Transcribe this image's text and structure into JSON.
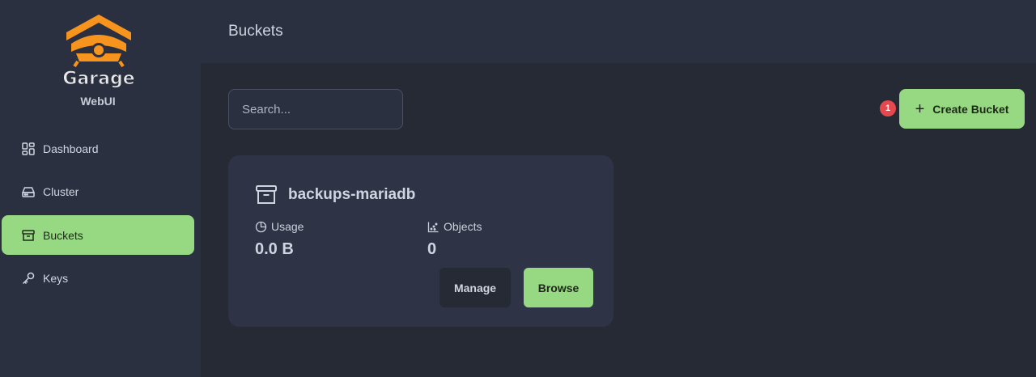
{
  "app": {
    "logo_text": "Garage",
    "subtitle": "WebUI"
  },
  "sidebar": {
    "items": [
      {
        "label": "Dashboard",
        "icon": "dashboard-icon",
        "active": false
      },
      {
        "label": "Cluster",
        "icon": "server-icon",
        "active": false
      },
      {
        "label": "Buckets",
        "icon": "archive-icon",
        "active": true
      },
      {
        "label": "Keys",
        "icon": "key-icon",
        "active": false
      }
    ]
  },
  "header": {
    "title": "Buckets"
  },
  "toolbar": {
    "search_placeholder": "Search...",
    "notification_count": "1",
    "create_label": "Create Bucket",
    "create_icon": "plus-icon"
  },
  "bucket": {
    "name": "backups-mariadb",
    "usage_label": "Usage",
    "usage_value": "0.0 B",
    "objects_label": "Objects",
    "objects_value": "0",
    "manage_label": "Manage",
    "browse_label": "Browse"
  },
  "colors": {
    "accent": "#97d982",
    "sidebar_bg": "#2b3040",
    "main_bg": "#262a35",
    "card_bg": "#2e3445",
    "badge": "#e5484d",
    "logo_orange": "#f7941d"
  }
}
